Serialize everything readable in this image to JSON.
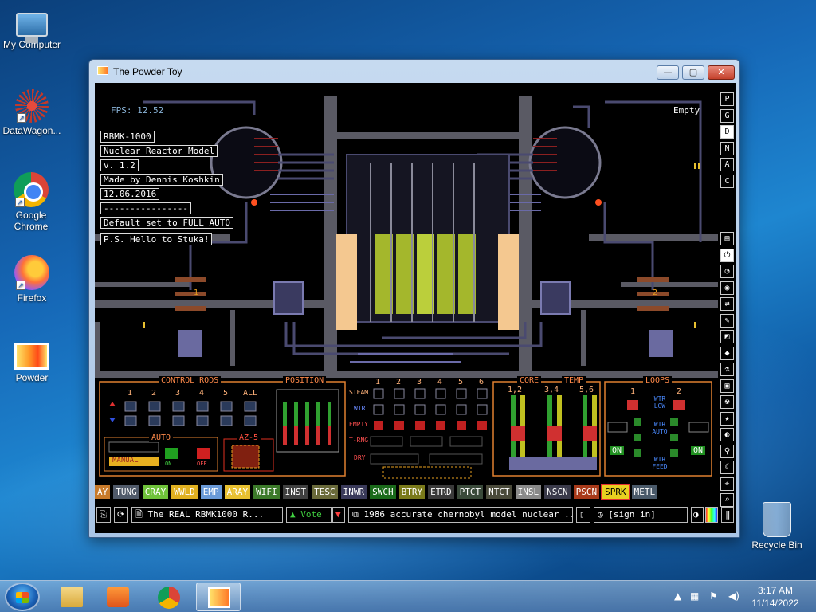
{
  "desktop": {
    "icons": [
      {
        "label": "My Computer"
      },
      {
        "label": "DataWagon..."
      },
      {
        "label": "Google Chrome"
      },
      {
        "label": "Firefox"
      },
      {
        "label": "Powder"
      },
      {
        "label": "Recycle Bin"
      }
    ]
  },
  "window": {
    "title": "The Powder Toy",
    "min_label": "—",
    "max_label": "▢",
    "close_label": "✕"
  },
  "sim": {
    "fps": "FPS: 12.52",
    "hover": "Empty",
    "notes": [
      "RBMK-1000",
      "Nuclear Reactor Model",
      "v. 1.2",
      "Made by Dennis Koshkin",
      "12.06.2016",
      "----------------",
      "Default set to FULL AUTO",
      "P.S. Hello to Stuka!"
    ],
    "panels": {
      "control_rods": "CONTROL RODS",
      "position": "POSITION",
      "core": "CORE",
      "temp": "TEMP",
      "loops": "LOOPS",
      "auto": "AUTO",
      "az5": "AZ-5",
      "manual": "MANUAL",
      "on": "ON",
      "off": "OFF",
      "rod_cols": [
        "1",
        "2",
        "3",
        "4",
        "5",
        "ALL"
      ],
      "pos_cols": [
        "1",
        "2",
        "3",
        "4",
        "5",
        "6"
      ],
      "pos_rows": [
        "STEAM",
        "WTR",
        "EMPTY",
        "T-RNG",
        "DRY"
      ],
      "core_cols": [
        "1,2",
        "3,4",
        "5,6"
      ],
      "loop_cols": [
        "1",
        "2"
      ],
      "wtr_low": "WTR LOW",
      "wtr_auto": "WTR AUTO",
      "wtr_feed": "WTR FEED",
      "loop_on": "ON",
      "loop_labels": [
        "1",
        "2"
      ]
    }
  },
  "right_menu": {
    "items": [
      "P",
      "G",
      "D",
      "N",
      "A",
      "C"
    ],
    "selected": "D",
    "tools": [
      "▤",
      "⏻",
      "◔",
      "◉",
      "⇄",
      "✎",
      "◩",
      "◆",
      "⚗",
      "▣",
      "☢",
      "★",
      "◐",
      "⚲",
      "☾",
      "⌖",
      "⌕"
    ]
  },
  "elements": [
    {
      "name": "AY",
      "color": "#c87a2a"
    },
    {
      "name": "TUNG",
      "color": "#505a6a"
    },
    {
      "name": "CRAY",
      "color": "#6fc23a"
    },
    {
      "name": "WWLD",
      "color": "#e0b020"
    },
    {
      "name": "EMP",
      "color": "#6a9ad8"
    },
    {
      "name": "ARAY",
      "color": "#e8c030"
    },
    {
      "name": "WIFI",
      "color": "#3c7a2a"
    },
    {
      "name": "INST",
      "color": "#404040"
    },
    {
      "name": "TESC",
      "color": "#6a6a3a"
    },
    {
      "name": "INWR",
      "color": "#3a3a5a"
    },
    {
      "name": "SWCH",
      "color": "#1a6a1a"
    },
    {
      "name": "BTRY",
      "color": "#7a7a1a"
    },
    {
      "name": "ETRD",
      "color": "#3a3a3a"
    },
    {
      "name": "PTCT",
      "color": "#3a4a3a"
    },
    {
      "name": "NTCT",
      "color": "#4a4a3a"
    },
    {
      "name": "INSL",
      "color": "#8a8a8a"
    },
    {
      "name": "NSCN",
      "color": "#3a3a4a"
    },
    {
      "name": "PSCN",
      "color": "#a83a1a"
    },
    {
      "name": "SPRK",
      "color": "#e8d020"
    },
    {
      "name": "METL",
      "color": "#4a5a6a"
    }
  ],
  "bottom_bar": {
    "save_title": "The REAL RBMK1000 R...",
    "vote": "Vote",
    "description": "1986 accurate chernobyl model nuclear ...",
    "sign_in": "[sign in]"
  },
  "taskbar": {
    "time": "3:17 AM",
    "date": "11/14/2022"
  }
}
